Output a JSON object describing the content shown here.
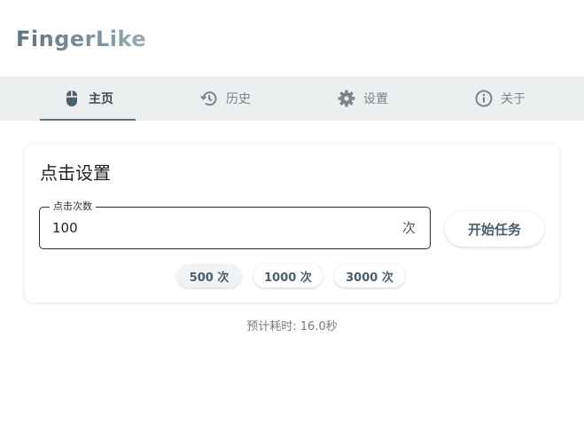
{
  "app": {
    "logo": "FingerLike"
  },
  "tabs": [
    {
      "label": "主页",
      "icon": "mouse-icon",
      "active": true
    },
    {
      "label": "历史",
      "icon": "history-icon",
      "active": false
    },
    {
      "label": "设置",
      "icon": "gear-icon",
      "active": false
    },
    {
      "label": "关于",
      "icon": "info-icon",
      "active": false
    }
  ],
  "card": {
    "title": "点击设置",
    "field_label": "点击次数",
    "field_value": "100",
    "field_suffix": "次",
    "start_label": "开始任务",
    "presets": [
      "500 次",
      "1000 次",
      "3000 次"
    ]
  },
  "estimate": "预计耗时: 16.0秒",
  "colors": {
    "accent": "#5d7280",
    "tabbar_bg": "#eceff0"
  }
}
